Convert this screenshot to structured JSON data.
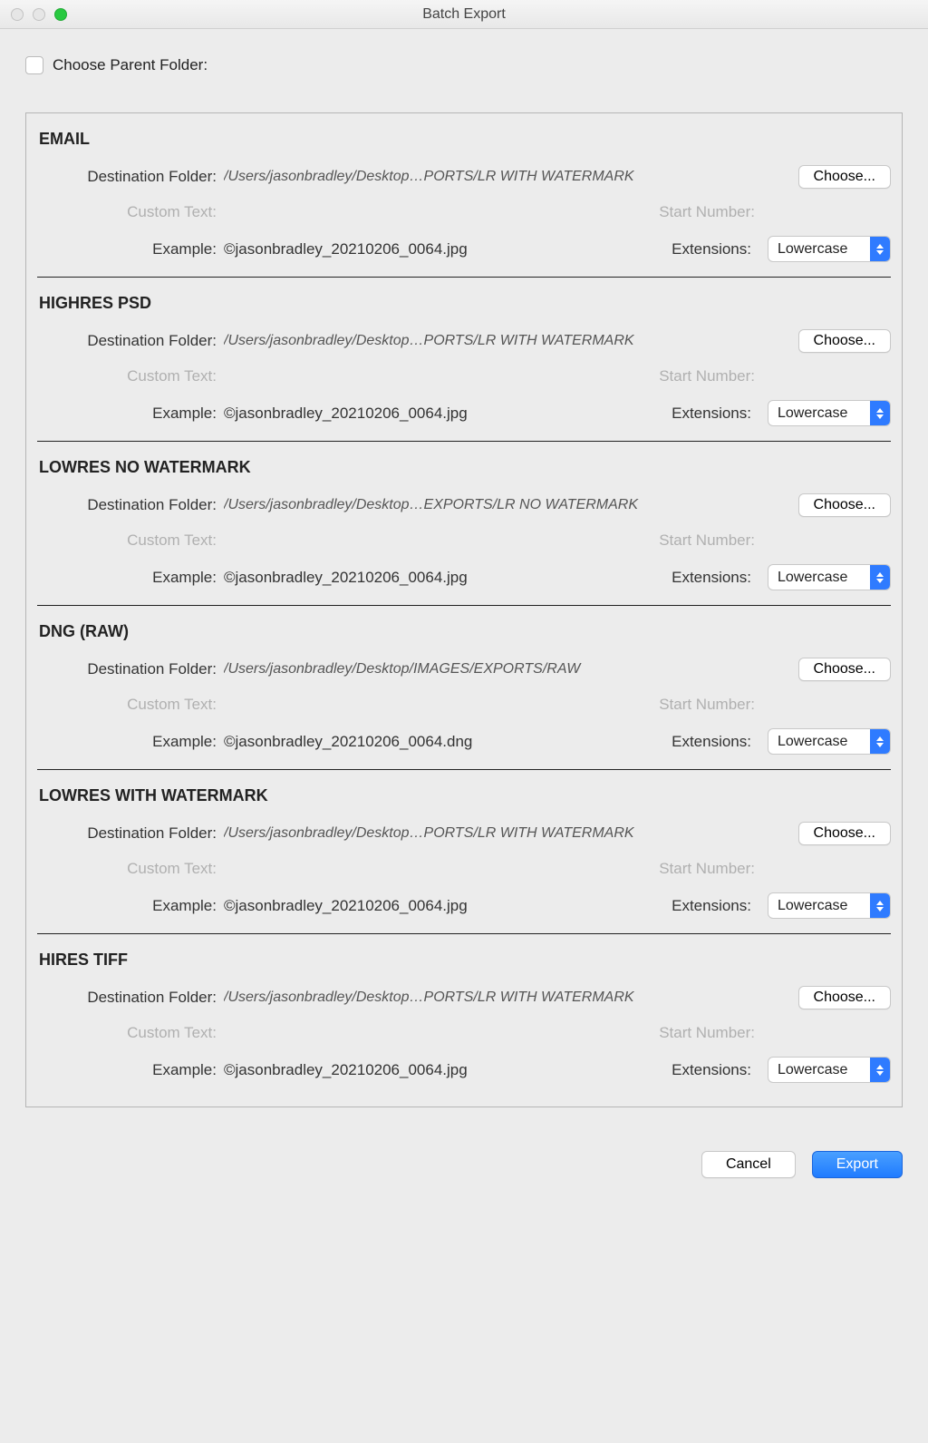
{
  "window": {
    "title": "Batch Export"
  },
  "parent_folder": {
    "label": "Choose Parent Folder:"
  },
  "labels": {
    "dest": "Destination Folder:",
    "custom": "Custom Text:",
    "start": "Start Number:",
    "example": "Example:",
    "ext": "Extensions:",
    "choose": "Choose..."
  },
  "presets": [
    {
      "name": "EMAIL",
      "path": "/Users/jasonbradley/Desktop…PORTS/LR WITH WATERMARK",
      "example": "©jasonbradley_20210206_0064.jpg",
      "ext": "Lowercase"
    },
    {
      "name": "HIGHRES PSD",
      "path": "/Users/jasonbradley/Desktop…PORTS/LR WITH WATERMARK",
      "example": "©jasonbradley_20210206_0064.jpg",
      "ext": "Lowercase"
    },
    {
      "name": "LOWRES NO WATERMARK",
      "path": "/Users/jasonbradley/Desktop…EXPORTS/LR NO WATERMARK",
      "example": "©jasonbradley_20210206_0064.jpg",
      "ext": "Lowercase"
    },
    {
      "name": "DNG (RAW)",
      "path": "/Users/jasonbradley/Desktop/IMAGES/EXPORTS/RAW",
      "example": "©jasonbradley_20210206_0064.dng",
      "ext": "Lowercase"
    },
    {
      "name": "LOWRES WITH WATERMARK",
      "path": "/Users/jasonbradley/Desktop…PORTS/LR WITH WATERMARK",
      "example": "©jasonbradley_20210206_0064.jpg",
      "ext": "Lowercase"
    },
    {
      "name": "HIRES TIFF",
      "path": "/Users/jasonbradley/Desktop…PORTS/LR WITH WATERMARK",
      "example": "©jasonbradley_20210206_0064.jpg",
      "ext": "Lowercase"
    }
  ],
  "footer": {
    "cancel": "Cancel",
    "export": "Export"
  }
}
